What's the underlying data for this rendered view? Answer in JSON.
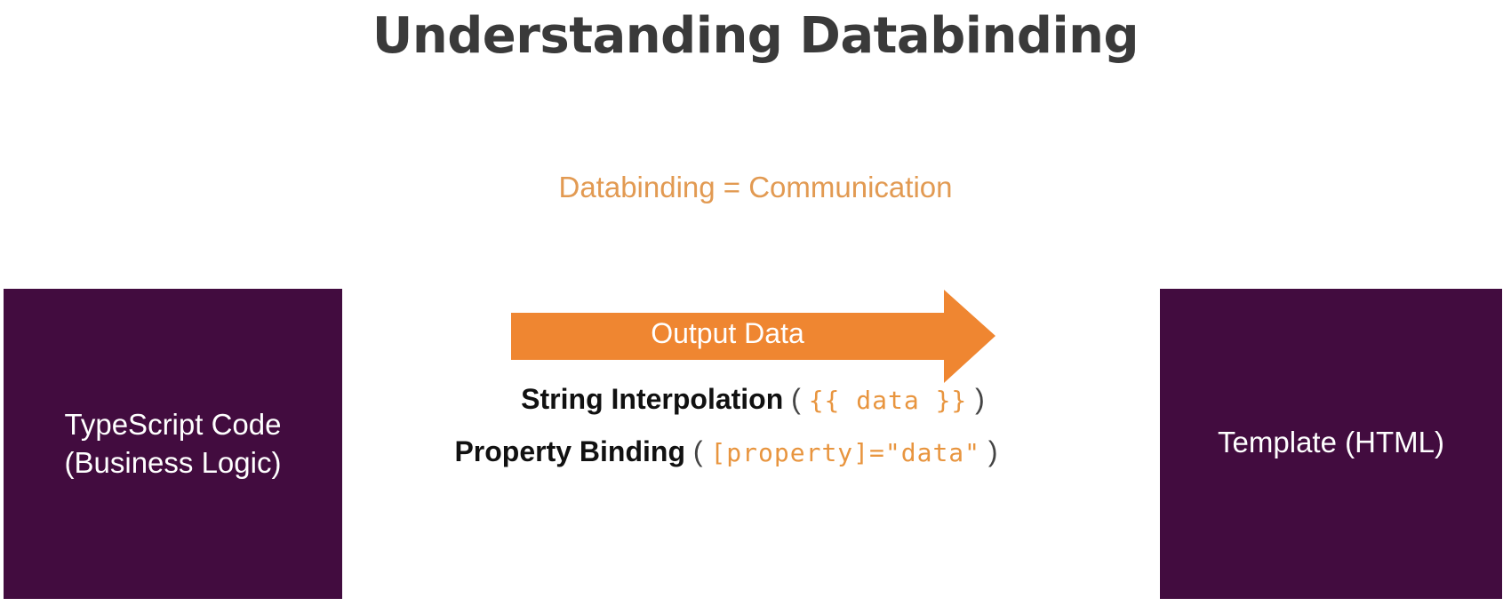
{
  "slide": {
    "title": "Understanding Databinding",
    "subtitle": "Databinding = Communication"
  },
  "left_box": {
    "line1": "TypeScript Code",
    "line2": "(Business Logic)"
  },
  "right_box": {
    "label": "Template (HTML)"
  },
  "arrow": {
    "label": "Output Data",
    "direction": "right"
  },
  "bindings": [
    {
      "name": "String Interpolation",
      "open": "(",
      "syntax": "{{ data }}",
      "close": ")"
    },
    {
      "name": "Property Binding",
      "open": "(",
      "syntax": "[property]=\"data\"",
      "close": ")"
    }
  ],
  "colors": {
    "title": "#3a3a3a",
    "accent_orange": "#ef8631",
    "subtitle_orange": "#e29a52",
    "box_purple": "#420c3f",
    "box_text": "#ffffff"
  }
}
